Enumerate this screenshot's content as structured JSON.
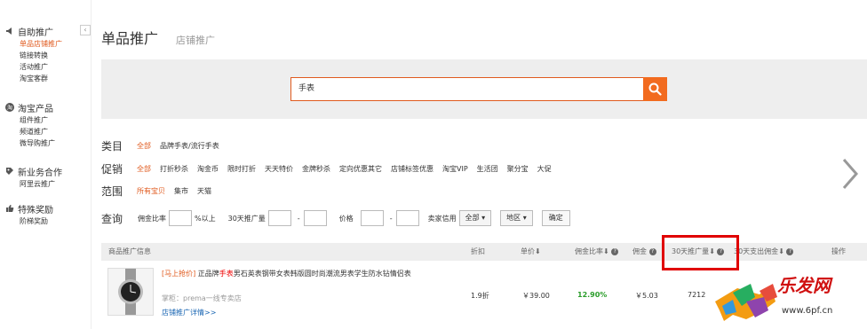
{
  "sidebar": {
    "collapse_glyph": "‹",
    "sections": [
      {
        "title": "自助推广",
        "icon": "megaphone-icon",
        "items": [
          "单品店铺推广",
          "链接转换",
          "活动推广",
          "淘宝客群"
        ],
        "active_index": 0
      },
      {
        "title": "淘宝产品",
        "icon": "taobao-icon",
        "items": [
          "组件推广",
          "频道推广",
          "微导购推广"
        ]
      },
      {
        "title": "新业务合作",
        "icon": "tag-icon",
        "items": [
          "阿里云推广"
        ]
      },
      {
        "title": "特殊奖励",
        "icon": "thumbs-up-icon",
        "items": [
          "阶梯奖励"
        ]
      }
    ]
  },
  "header": {
    "title": "单品推广",
    "secondary_tab": "店铺推广"
  },
  "search": {
    "value": "手表"
  },
  "filters": {
    "category": {
      "label": "类目",
      "options": [
        "全部",
        "品牌手表/流行手表"
      ]
    },
    "promo": {
      "label": "促销",
      "options": [
        "全部",
        "打折秒杀",
        "淘金币",
        "限时打折",
        "天天特价",
        "金牌秒杀",
        "定向优惠其它",
        "店铺标签优惠",
        "淘宝VIP",
        "生活团",
        "聚分宝",
        "大促"
      ]
    },
    "scope": {
      "label": "范围",
      "options": [
        "所有宝贝",
        "集市",
        "天猫"
      ]
    }
  },
  "query": {
    "label": "查询",
    "commission_label": "佣金比率",
    "commission_suffix": "%以上",
    "sales_label": "30天推广量",
    "dash": "-",
    "price_label": "价格",
    "credit_label": "卖家信用",
    "credit_value": "全部",
    "region_value": "地区",
    "confirm_label": "确定"
  },
  "table": {
    "headers": [
      "商品推广信息",
      "折扣",
      "单价",
      "佣金比率",
      "佣金",
      "30天推广量",
      "30天支出佣金",
      "操作"
    ],
    "row": {
      "tag": "[马上抢价]",
      "title_a": "正品",
      "title_b": "牌",
      "keyword": "手表",
      "title_rest": "男石英表钢带女表韩版圆时尚潮流男表学生防水钻情侣表",
      "shop": "掌柜：prema一线专卖店",
      "detail_link": "店铺推广详情>>",
      "discount": "1.9折",
      "price": "￥39.00",
      "commission_rate": "12.90%",
      "commission": "￥5.03",
      "sales_30d": "7212"
    }
  },
  "watermark": {
    "text": "乐发网",
    "url": "www.6pf.cn"
  },
  "colors": {
    "accent": "#e05a1e",
    "search_button": "#f26b1f",
    "highlight_box": "#e00000",
    "rate_green": "#2a9d2a",
    "link_blue": "#1a66b3"
  }
}
